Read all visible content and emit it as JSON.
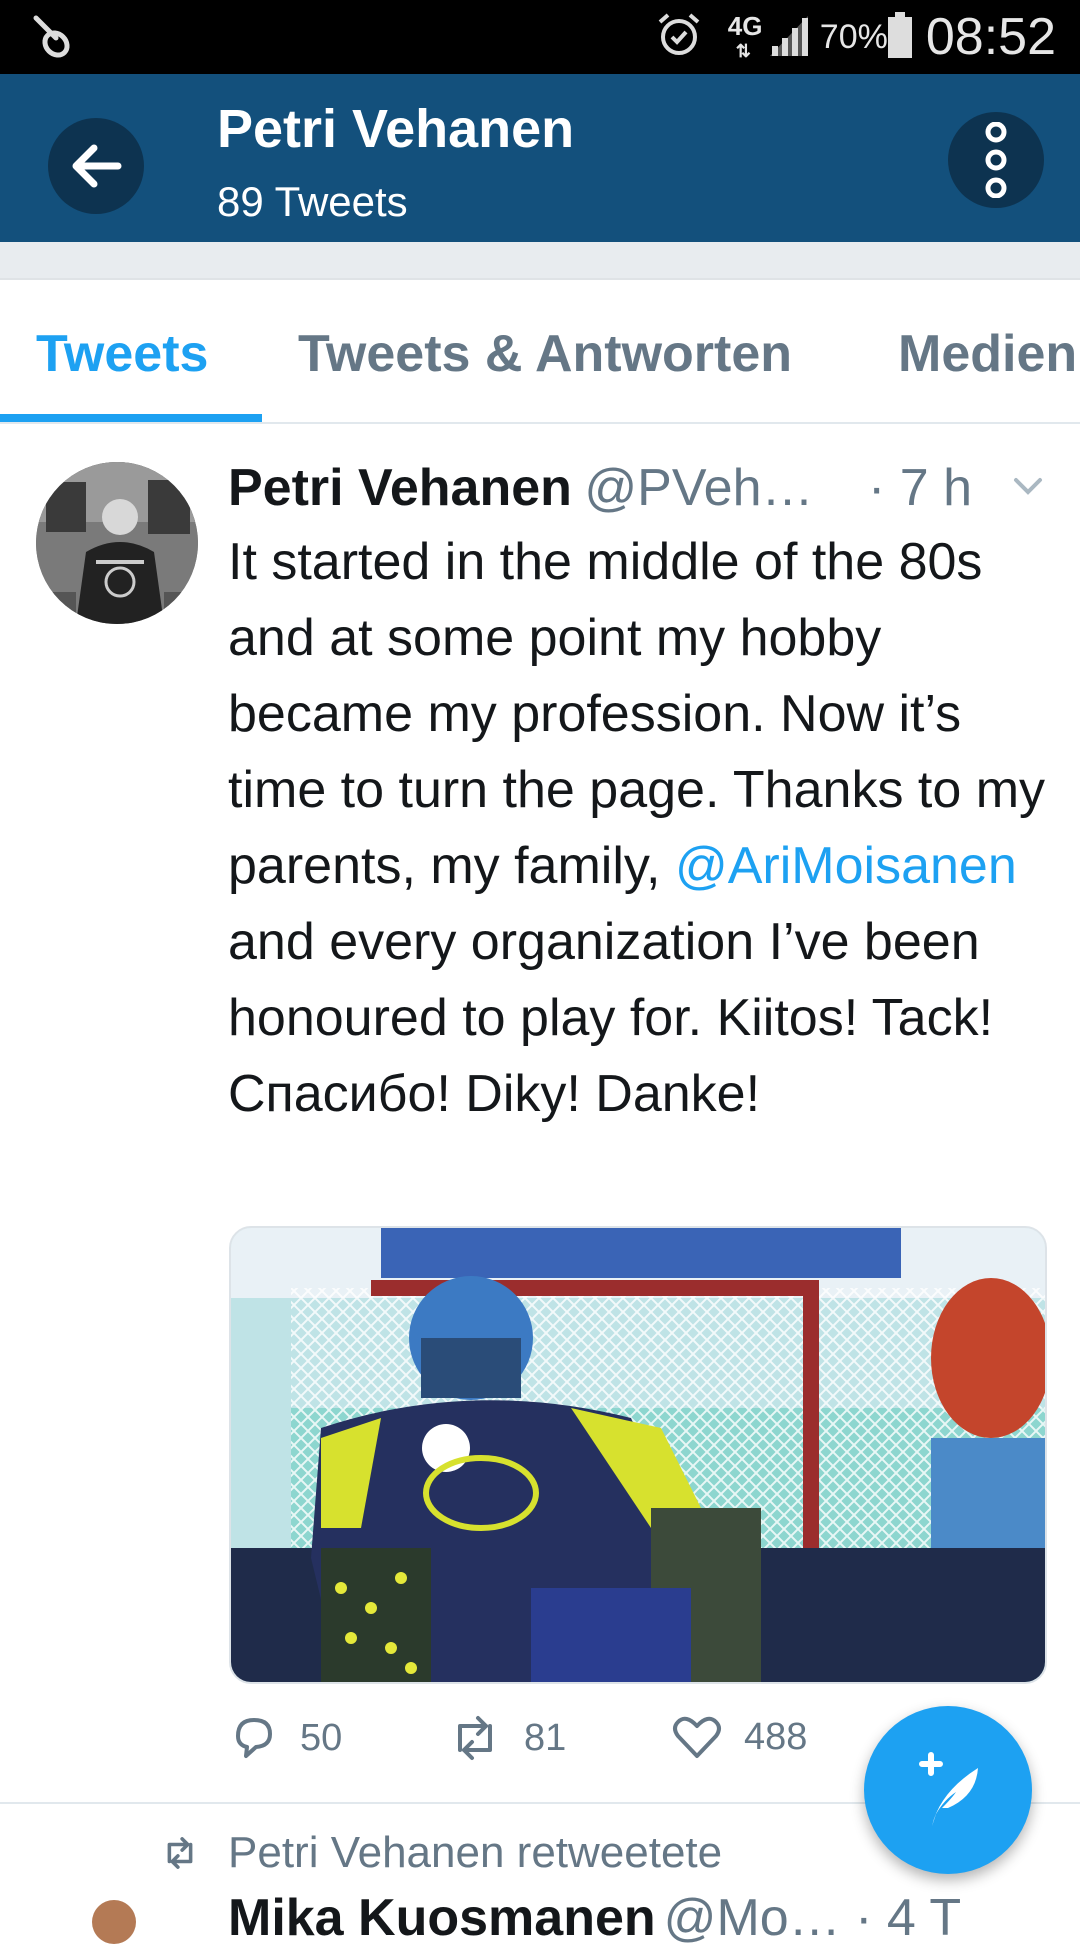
{
  "status_bar": {
    "network": "4G",
    "battery_percent": "70%",
    "time": "08:52",
    "icons": [
      "pin-icon",
      "alarm-icon",
      "signal-icon",
      "battery-icon"
    ]
  },
  "app_bar": {
    "title": "Petri Vehanen",
    "subtitle": "89 Tweets",
    "back_icon": "arrow-left-icon",
    "menu_icon": "more-vertical-icon"
  },
  "tabs": [
    {
      "label": "Tweets",
      "active": true
    },
    {
      "label": "Tweets & Antworten",
      "active": false
    },
    {
      "label": "Medien",
      "active": false
    }
  ],
  "tweet": {
    "name": "Petri Vehanen",
    "handle": "@PVeh…",
    "time": "· 7 h",
    "text_before": "It started in the middle of the 80s and at some point my hobby became my profession. Now it’s time to turn the page. Thanks to my parents, my family, ",
    "mention": "@AriMoisanen",
    "text_after": " and every organization I’ve been honoured to play for. Kiitos! Tack! Спасибо! Diky! Danke!",
    "replies": "50",
    "retweets": "81",
    "likes": "488"
  },
  "next_item": {
    "retweet_label": "Petri Vehanen retweetete",
    "name": "Mika Kuosmanen",
    "handle": "@Mo… · 4 T"
  },
  "colors": {
    "app_bar": "#13507c",
    "accent": "#1da1f2",
    "muted": "#657786"
  }
}
